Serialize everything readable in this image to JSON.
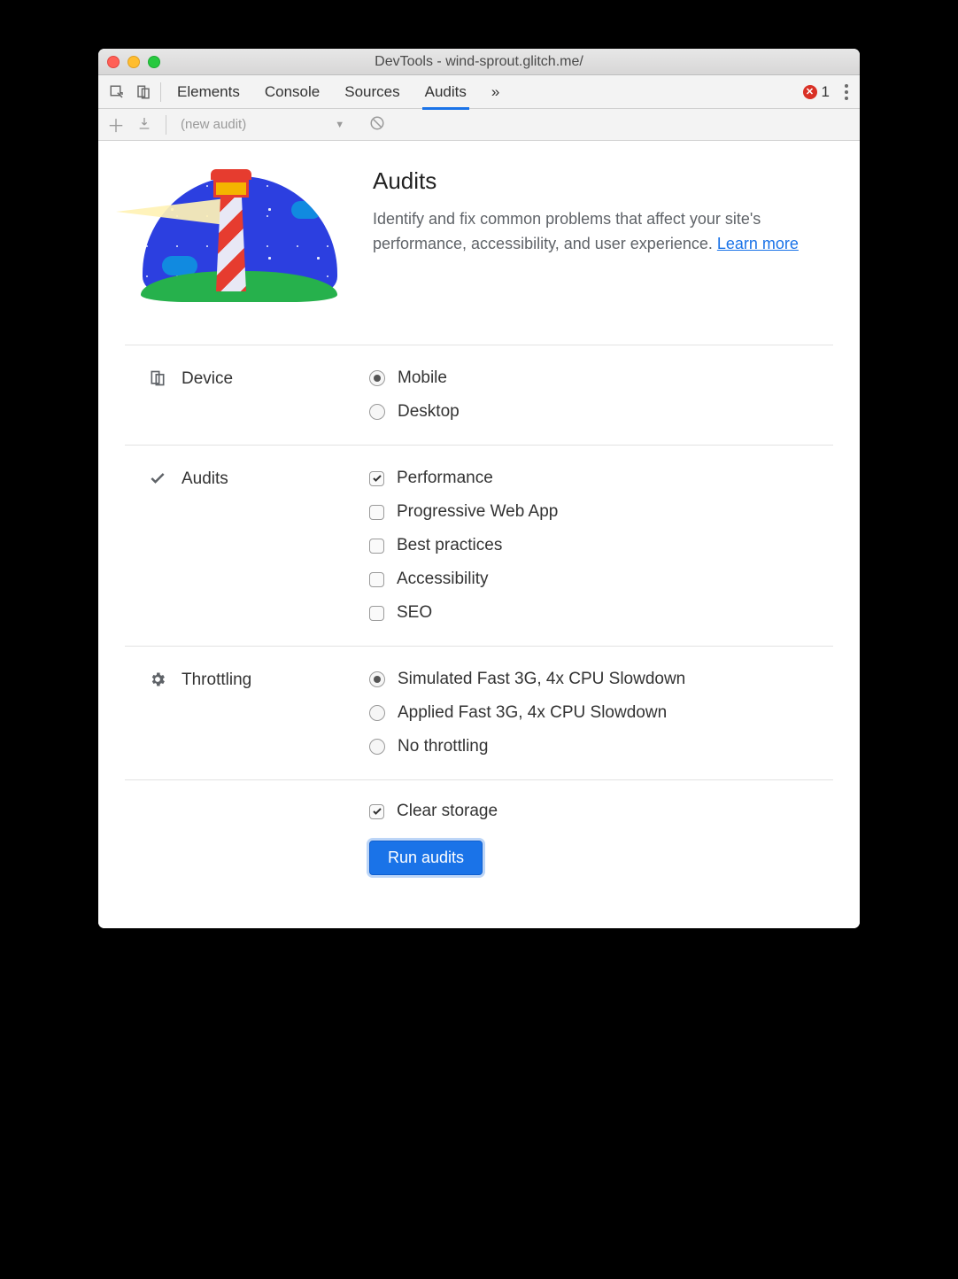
{
  "window": {
    "title": "DevTools - wind-sprout.glitch.me/"
  },
  "tabs": {
    "items": [
      "Elements",
      "Console",
      "Sources",
      "Audits"
    ],
    "active_index": 3,
    "overflow_glyph": "»",
    "error_count": "1"
  },
  "toolbar": {
    "audit_dropdown_label": "(new audit)",
    "dropdown_glyph": "▼"
  },
  "hero": {
    "title": "Audits",
    "desc_prefix": "Identify and fix common problems that affect your site's performance, accessibility, and user experience. ",
    "learn_more": "Learn more"
  },
  "sections": {
    "device": {
      "label": "Device",
      "options": [
        {
          "label": "Mobile",
          "checked": true
        },
        {
          "label": "Desktop",
          "checked": false
        }
      ]
    },
    "audits": {
      "label": "Audits",
      "options": [
        {
          "label": "Performance",
          "checked": true
        },
        {
          "label": "Progressive Web App",
          "checked": false
        },
        {
          "label": "Best practices",
          "checked": false
        },
        {
          "label": "Accessibility",
          "checked": false
        },
        {
          "label": "SEO",
          "checked": false
        }
      ]
    },
    "throttling": {
      "label": "Throttling",
      "options": [
        {
          "label": "Simulated Fast 3G, 4x CPU Slowdown",
          "checked": true
        },
        {
          "label": "Applied Fast 3G, 4x CPU Slowdown",
          "checked": false
        },
        {
          "label": "No throttling",
          "checked": false
        }
      ]
    },
    "clear_storage": {
      "label": "Clear storage",
      "checked": true
    }
  },
  "run_button": "Run audits"
}
